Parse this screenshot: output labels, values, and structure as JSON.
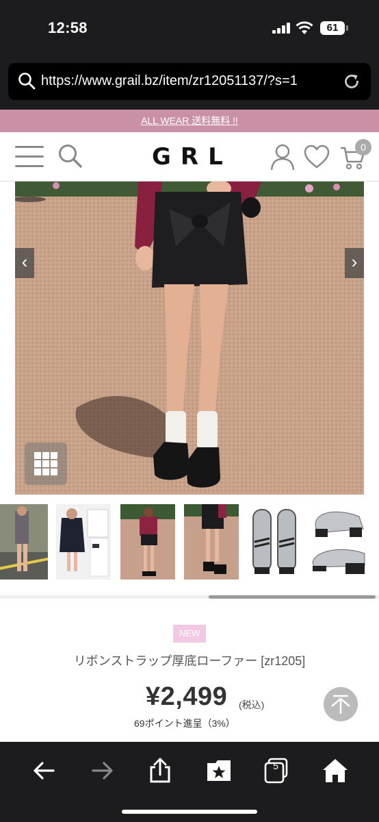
{
  "status_bar": {
    "time": "12:58",
    "battery": "61"
  },
  "browser": {
    "url": "https://www.grail.bz/item/zr12051137/?s=1"
  },
  "promo": {
    "text": "ALL WEAR 送料無料 !!"
  },
  "header": {
    "logo": "GRL",
    "cart_count": "0"
  },
  "gallery": {
    "prev": "‹",
    "next": "›",
    "thumbnail_count": 6,
    "scroll_position": 0.55
  },
  "product": {
    "badge": "NEW",
    "name": "リボンストラップ厚底ローファー [zr1205]",
    "price": "¥2,499",
    "tax_note": "(税込)",
    "points": "69ポイント進呈（3%）"
  },
  "toolbar": {
    "tabs_count": "5"
  },
  "colors": {
    "promo_bg": "#c990a7",
    "badge_bg": "#f2c9e3",
    "chrome_bg": "#1c1c1e"
  }
}
